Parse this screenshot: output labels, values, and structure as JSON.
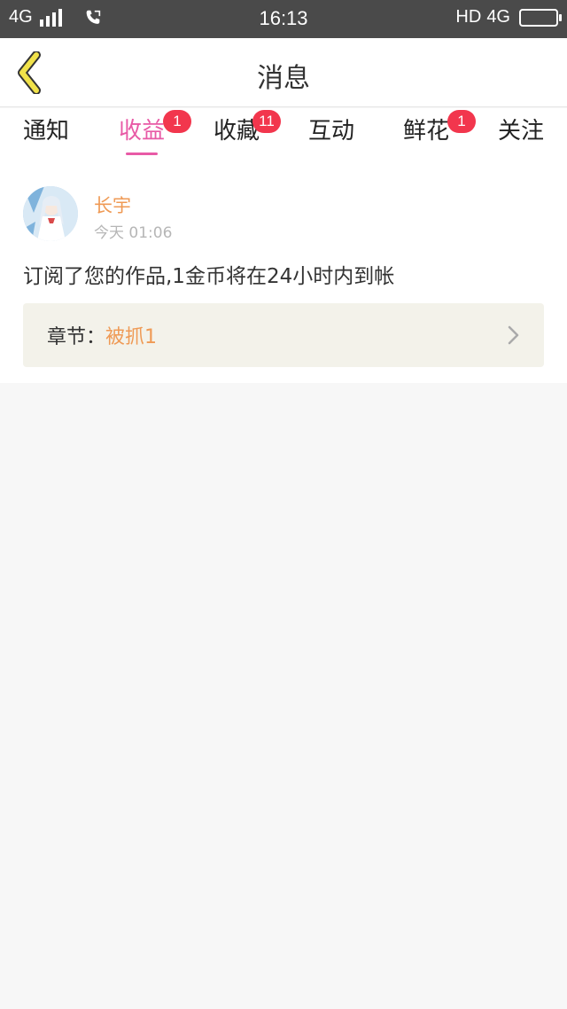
{
  "status_bar": {
    "network_left": "4G",
    "time": "16:13",
    "hd": "HD",
    "network_right": "4G"
  },
  "nav": {
    "title": "消息",
    "back_icon": "chevron-left-icon",
    "back_color": "#f1e24a"
  },
  "tabs": [
    {
      "label": "通知",
      "badge": ""
    },
    {
      "label": "收益",
      "badge": "1",
      "active": true
    },
    {
      "label": "收藏",
      "badge": "11"
    },
    {
      "label": "互动",
      "badge": ""
    },
    {
      "label": "鲜花",
      "badge": "1"
    },
    {
      "label": "关注",
      "badge": ""
    }
  ],
  "message": {
    "username": "长宇",
    "time": "今天 01:06",
    "text": "订阅了您的作品,1金币将在24小时内到帐",
    "chapter_label": "章节：",
    "chapter_name": "被抓1"
  },
  "colors": {
    "accent_pink": "#e85aa6",
    "badge_red": "#f2364d",
    "username_orange": "#ef9a55"
  }
}
